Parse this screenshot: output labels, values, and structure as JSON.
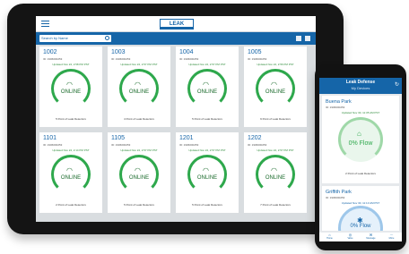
{
  "tablet": {
    "logo": "LEAK",
    "search": {
      "placeholder": "Search by Name"
    },
    "cards": [
      {
        "title": "1002",
        "id": "ID: 1906000253",
        "updated": "Updated Nov 24, 2:58 PM PST",
        "status": "ONLINE",
        "footer": "5 Point of Leak Detectors"
      },
      {
        "title": "1003",
        "id": "ID: 1906000253",
        "updated": "Updated Nov 24, 2:57 PM PST",
        "status": "ONLINE",
        "footer": "4 Point of Leak Detectors"
      },
      {
        "title": "1004",
        "id": "ID: 1906000253",
        "updated": "Updated Nov 24, 2:57 PM PST",
        "status": "ONLINE",
        "footer": "5 Point of Leak Detectors"
      },
      {
        "title": "1005",
        "id": "ID: 1906000253",
        "updated": "Updated Nov 24, 2:56 PM PST",
        "status": "ONLINE",
        "footer": "9 Point of Leak Detectors"
      },
      {
        "title": "1101",
        "id": "ID: 1906000253",
        "updated": "Updated Nov 24, 2:14 PM PST",
        "status": "ONLINE",
        "footer": "2 Point of Leak Detectors"
      },
      {
        "title": "1105",
        "id": "ID: 1906000253",
        "updated": "Updated Nov 24, 2:57 PM PST",
        "status": "ONLINE",
        "footer": "5 Point of Leak Detectors"
      },
      {
        "title": "1201",
        "id": "ID: 1906000253",
        "updated": "Updated Nov 24, 2:57 PM PST",
        "status": "ONLINE",
        "footer": "5 Point of Leak Detectors"
      },
      {
        "title": "1202",
        "id": "ID: 1906000253",
        "updated": "Updated Nov 24, 2:57 PM PST",
        "status": "ONLINE",
        "footer": "7 Point of Leak Detectors"
      }
    ]
  },
  "phone": {
    "title": "Leak Defense",
    "subtitle": "My Devices",
    "refresh_icon": "refresh-icon",
    "card1": {
      "title": "Buena Park",
      "id": "ID: 1906000253",
      "updated": "Updated Nov 30, 11:35 AM PST",
      "flow": "0% Flow",
      "footer": "2 Point of Leak Detectors"
    },
    "card2": {
      "title": "Griffith Park",
      "id": "ID: 1906000253",
      "updated": "Updated Nov 30, 11:13 AM PST",
      "flow": "0% Flow"
    },
    "nav": [
      {
        "label": "Home",
        "icon": "home-icon"
      },
      {
        "label": "Valve",
        "icon": "valve-icon"
      },
      {
        "label": "Message",
        "icon": "message-icon"
      },
      {
        "label": "More",
        "icon": "more-icon"
      }
    ]
  },
  "colors": {
    "brand_blue": "#1565a8",
    "online_green": "#2ea84c"
  }
}
